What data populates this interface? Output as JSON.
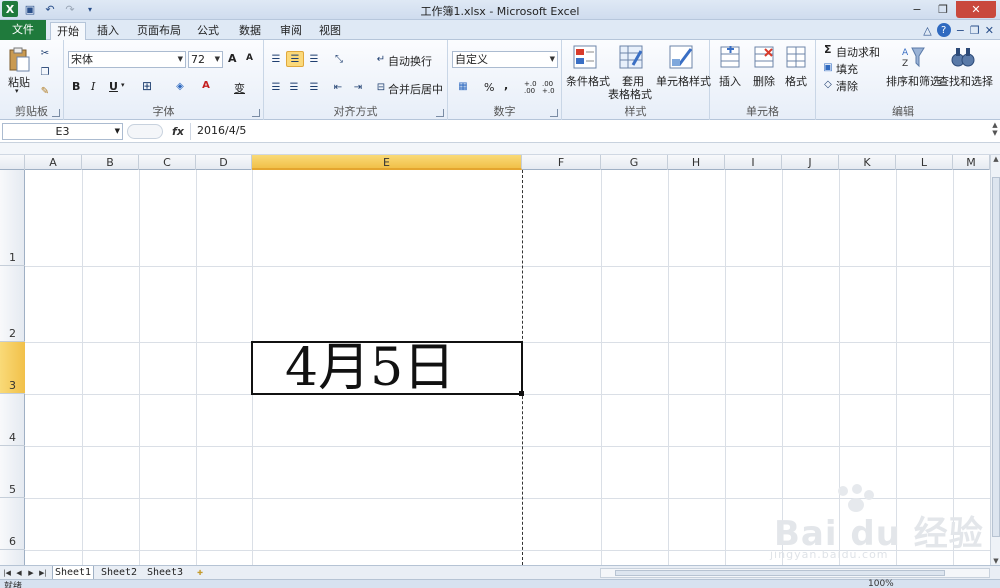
{
  "window": {
    "title": "工作簿1.xlsx - Microsoft Excel",
    "controls": [
      "−",
      "❐",
      "✕"
    ]
  },
  "qat": {
    "save_icon": "save-icon",
    "undo_icon": "undo-icon",
    "redo_icon": "redo-icon"
  },
  "tabs": [
    {
      "label": "文件"
    },
    {
      "label": "开始"
    },
    {
      "label": "插入"
    },
    {
      "label": "页面布局"
    },
    {
      "label": "公式"
    },
    {
      "label": "数据"
    },
    {
      "label": "审阅"
    },
    {
      "label": "视图"
    }
  ],
  "ribbon": {
    "clipboard": {
      "label": "剪贴板",
      "paste": "粘贴"
    },
    "font": {
      "label": "字体",
      "name": "宋体",
      "size": "72",
      "bold": "B",
      "italic": "I",
      "underline": "U",
      "grow": "A",
      "shrink": "A",
      "phonetic": "变"
    },
    "alignment": {
      "label": "对齐方式",
      "wrap": "自动换行",
      "merge": "合并后居中"
    },
    "number": {
      "label": "数字",
      "format": "自定义",
      "percent": "%",
      "comma": ",",
      "inc": "+.0 .00",
      "dec": ".00 +.0"
    },
    "styles": {
      "label": "样式",
      "conditional": "条件格式",
      "table_format_1": "套用",
      "table_format_2": "表格格式",
      "cell_styles": "单元格样式"
    },
    "cells": {
      "label": "单元格",
      "insert": "插入",
      "delete": "删除",
      "format": "格式"
    },
    "editing": {
      "label": "编辑",
      "autosum": "自动求和",
      "fill": "填充",
      "clear": "清除",
      "sort_filter": "排序和筛选",
      "find_select": "查找和选择"
    }
  },
  "formula_bar": {
    "name_box": "E3",
    "fx": "fx",
    "content": "2016/4/5"
  },
  "columns": [
    "A",
    "B",
    "C",
    "D",
    "E",
    "F",
    "G",
    "H",
    "I",
    "J",
    "K",
    "L",
    "M"
  ],
  "rows": [
    "1",
    "2",
    "3",
    "4",
    "5",
    "6"
  ],
  "active_cell": {
    "ref": "E3",
    "display": "4月5日"
  },
  "sheets": {
    "tabs": [
      "Sheet1",
      "Sheet2",
      "Sheet3"
    ],
    "active": "Sheet1"
  },
  "status": {
    "ready": "就绪",
    "zoom": "100%"
  },
  "watermark": {
    "logo": "Bai du 经验",
    "url": "jingyan.baidu.com"
  },
  "colors": {
    "file_tab": "#1f7a3c",
    "selection_header": "#f1c049",
    "ribbon_bg": "#e7eef8"
  }
}
